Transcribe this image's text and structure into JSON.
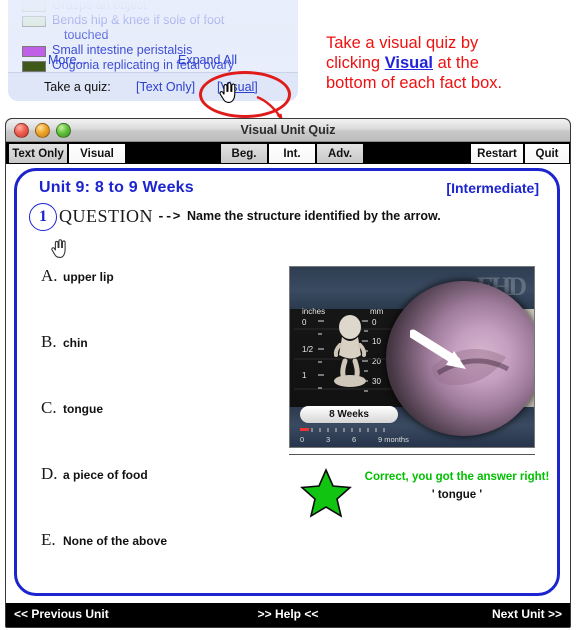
{
  "fact_box": {
    "items": [
      {
        "label": "Grasps an object",
        "color": "#cfe8c6"
      },
      {
        "label": "Bends hip & knee if sole of foot",
        "color": "#cfe8c6"
      },
      {
        "label": "touched",
        "color": "",
        "continuation": true
      },
      {
        "label": "Small intestine peristalsis",
        "color": "#c060e8"
      },
      {
        "label": "Oogonia replicating in fetal ovary",
        "color": "#3f5a18"
      }
    ],
    "more_label": "More...",
    "expand_label": "Expand All",
    "quiz_prompt": "Take a quiz:",
    "text_only_link": "[Text Only]",
    "visual_link": "[Visual]"
  },
  "annotation": {
    "line1_before": "Take a visual quiz by",
    "line2_before": "clicking ",
    "line2_link": "Visual",
    "line2_after": " at the",
    "line3": "bottom of each fact box.",
    "color": "#ee1111",
    "link_color": "#2222dd"
  },
  "window": {
    "title": "Visual Unit Quiz",
    "lights": [
      "close-button",
      "minimize-button",
      "maximize-button"
    ],
    "toolbar": {
      "left": [
        {
          "label": "Text Only",
          "state": "gray"
        },
        {
          "label": "Visual",
          "state": "white"
        }
      ],
      "center": [
        {
          "label": "Beg.",
          "state": "gray"
        },
        {
          "label": "Int.",
          "state": "white"
        },
        {
          "label": "Adv.",
          "state": "gray"
        }
      ],
      "right": [
        {
          "label": "Restart",
          "state": "white"
        },
        {
          "label": "Quit",
          "state": "white"
        }
      ]
    }
  },
  "quiz": {
    "unit_title": "Unit 9:   8 to 9 Weeks",
    "level": "[Intermediate]",
    "question_number": "1",
    "question_word": "QUESTION",
    "question_arrow": "-->",
    "question_text": "Name the structure identified by the arrow.",
    "accent_color": "#1c24cf",
    "answers": [
      {
        "letter": "A.",
        "text": "upper lip"
      },
      {
        "letter": "B.",
        "text": "chin"
      },
      {
        "letter": "C.",
        "text": "tongue"
      },
      {
        "letter": "D.",
        "text": "a piece of food"
      },
      {
        "letter": "E.",
        "text": "None of the above"
      }
    ],
    "media": {
      "watermark": "EHD",
      "scale_left_label": "inches",
      "scale_right_label": "mm",
      "left_ticks": [
        "0",
        "1/2",
        "1"
      ],
      "right_ticks": [
        "0",
        "10",
        "20",
        "30"
      ],
      "age_pill": "8 Weeks",
      "timeline_ticks": [
        "0",
        "3",
        "6",
        "9 months"
      ]
    },
    "feedback": {
      "icon": "green-star",
      "correct_text": "Correct, you got the answer right!",
      "answer_text": "' tongue '",
      "correct_color": "#00c000"
    }
  },
  "bottom_nav": {
    "previous": "<< Previous Unit",
    "help": ">> Help <<",
    "next": "Next Unit >>"
  }
}
